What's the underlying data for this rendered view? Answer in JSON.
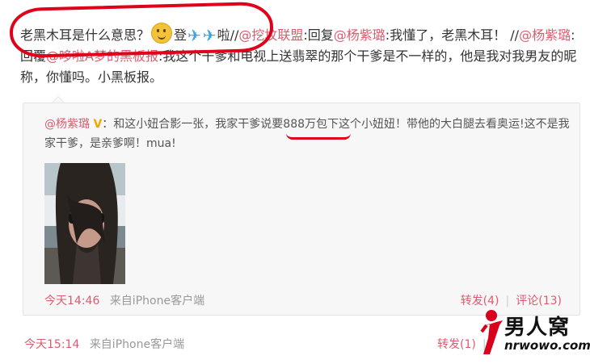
{
  "main_post": {
    "text_1": "老黑木耳是什么意思？",
    "text_2": "登",
    "text_3": "啦//",
    "mention_1": "@挖坟联盟",
    "text_4": ":回复",
    "mention_2": "@杨紫璐",
    "text_5": ":我懂了，老黑木耳！ //",
    "mention_3": "@杨紫璐",
    "text_6": ":回覆",
    "mention_4": "@哆啦A梦的黑板报",
    "text_7": ":我这个干爹和电视上送翡翠的那个干爹是不一样的，他是我对我男友的昵称，你懂吗。小黑板报。"
  },
  "repost": {
    "author": "@杨紫璐",
    "text": "：和这小妞合影一张，我家干爹说要888万包下这个小妞妞！带他的大白腿去看奥运!这不是我家干爹，是亲爹啊！mua!",
    "time": "今天14:46",
    "source": "来自iPhone客户端",
    "repost_label": "转发(4)",
    "comment_label": "评论(13)",
    "separator": "|"
  },
  "footer": {
    "time": "今天15:14",
    "source": "来自iPhone客户端",
    "repost_label": "转发(1)",
    "separator": "|"
  },
  "watermark": {
    "brand": "男人窝",
    "url": "nrwowo.com"
  },
  "colors": {
    "link": "#e05a6e",
    "annotation_red": "#e0001a",
    "repost_bg": "#f7f7f7"
  }
}
